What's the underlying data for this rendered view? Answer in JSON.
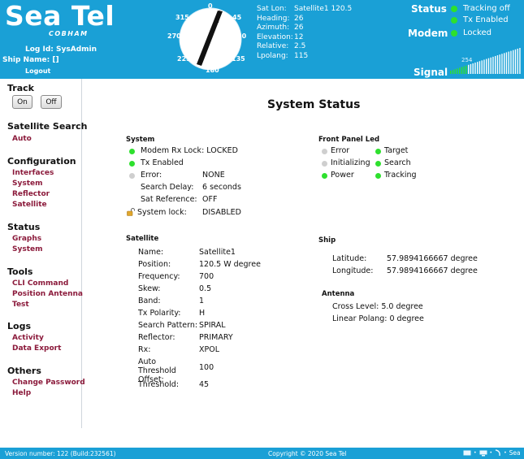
{
  "header": {
    "brand": "Sea Tel",
    "sub_brand": "COBHAM",
    "log_id": "Log Id: SysAdmin",
    "ship_name": "Ship Name: []",
    "logout": "Logout",
    "compass_labels": {
      "n": "0",
      "ne": "45",
      "e": "90",
      "se": "135",
      "s": "180",
      "sw": "225",
      "w": "270",
      "nw": "315"
    },
    "readouts": [
      {
        "k": "Sat Lon:",
        "v": "Satellite1 120.5"
      },
      {
        "k": "Heading:",
        "v": "26"
      },
      {
        "k": "Azimuth:",
        "v": "26"
      },
      {
        "k": "Elevation:",
        "v": "12"
      },
      {
        "k": "Relative:",
        "v": "2.5"
      },
      {
        "k": "Lpolang:",
        "v": "115"
      }
    ],
    "status_label": "Status",
    "status_items": [
      "Tracking off",
      "Tx Enabled"
    ],
    "modem_label": "Modem",
    "modem_item": "Locked",
    "signal_label": "Signal",
    "signal_value": "254",
    "accent": "#1aa0d6",
    "indicator_green": "#2ee02e"
  },
  "sidebar": {
    "track": "Track",
    "on_button": "On",
    "off_button": "Off",
    "satellite_search": "Satellite Search",
    "auto": "Auto",
    "configuration": "Configuration",
    "config_items": [
      "Interfaces",
      "System",
      "Reflector",
      "Satellite"
    ],
    "status": "Status",
    "status_items": [
      "Graphs",
      "System"
    ],
    "tools": "Tools",
    "tools_items": [
      "CLI Command",
      "Position Antenna",
      "Test"
    ],
    "logs": "Logs",
    "logs_items": [
      "Activity",
      "Data Export"
    ],
    "others": "Others",
    "others_items": [
      "Change Password",
      "Help"
    ]
  },
  "main": {
    "title": "System Status",
    "system": {
      "heading": "System",
      "modem_rx_lock": "Modem Rx Lock: LOCKED",
      "tx_enabled": "Tx Enabled",
      "error_k": "Error:",
      "error_v": "NONE",
      "search_delay_k": "Search Delay:",
      "search_delay_v": "6 seconds",
      "sat_ref_k": "Sat Reference:",
      "sat_ref_v": "OFF",
      "system_lock_k": "System lock:",
      "system_lock_v": "DISABLED"
    },
    "front_panel": {
      "heading": "Front Panel Led",
      "error": "Error",
      "target": "Target",
      "initializing": "Initializing",
      "search": "Search",
      "power": "Power",
      "tracking": "Tracking"
    },
    "satellite": {
      "heading": "Satellite",
      "rows": [
        {
          "k": "Name:",
          "v": "Satellite1"
        },
        {
          "k": "Position:",
          "v": "120.5 W degree"
        },
        {
          "k": "Frequency:",
          "v": "700"
        },
        {
          "k": "Skew:",
          "v": "0.5"
        },
        {
          "k": "Band:",
          "v": "1"
        },
        {
          "k": "Tx Polarity:",
          "v": "H"
        },
        {
          "k": "Search Pattern:",
          "v": "SPIRAL"
        },
        {
          "k": "Reflector:",
          "v": "PRIMARY"
        },
        {
          "k": "Rx:",
          "v": "XPOL"
        },
        {
          "k": "Auto Threshold Offset:",
          "v": "100"
        },
        {
          "k": "Threshold:",
          "v": "45"
        }
      ]
    },
    "ship": {
      "heading": "Ship",
      "latitude_k": "Latitude:",
      "latitude_v": "57.9894166667 degree",
      "longitude_k": "Longitude:",
      "longitude_v": "57.9894166667 degree"
    },
    "antenna": {
      "heading": "Antenna",
      "cross_level": "Cross Level:  5.0 degree",
      "linear_polang": "Linear Polang: 0 degree"
    }
  },
  "footer": {
    "version": "Version number: 122 (Build:232561)",
    "copyright": "Copyright © 2020 Sea Tel",
    "right_text": "Sea"
  }
}
